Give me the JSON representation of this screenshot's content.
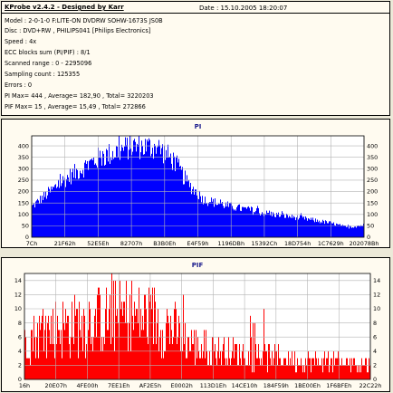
{
  "info": {
    "app_title": "KProbe v2.4.2 - Designed by Karr",
    "date_line": "Date : 15.10.2005 18:20:07",
    "lines": [
      "Model : 2-0-1-0 F:LITE-ON DVDRW SOHW-1673S JS0B",
      "Disc : DVD+RW , PHILIPS041 [Philips Electronics]",
      "Speed : 4x",
      "ECC blocks sum (PI/PIF) : 8/1",
      "Scanned range : 0 - 2295096",
      "Sampling count : 125355",
      "Errors : 0",
      "PI Max= 444 , Average= 182,90 , Total= 3220203",
      "PIF Max= 15 , Average= 15,49 , Total= 272866"
    ]
  },
  "colors": {
    "pi": "#0000ff",
    "pif": "#ff0000",
    "grid": "#b4b4b4",
    "title": "#1a1a8c"
  },
  "chart_data": [
    {
      "type": "bar",
      "title": "PI",
      "ylim": [
        0,
        444
      ],
      "yticks": [
        0,
        50,
        100,
        150,
        200,
        250,
        300,
        350,
        400
      ],
      "xtick_labels": [
        "7Ch",
        "21F62h",
        "52E5Eh",
        "82707h",
        "B3B0Eh",
        "E4F59h",
        "1196DBh",
        "15392Ch",
        "18D754h",
        "1C7629h",
        "202078Bh"
      ],
      "grid": true,
      "profile_x": [
        0,
        0.1,
        0.2,
        0.3,
        0.38,
        0.43,
        0.47,
        0.52,
        0.6,
        0.7,
        0.8,
        0.9,
        0.95,
        1.0
      ],
      "profile_y": [
        140,
        265,
        360,
        415,
        410,
        345,
        245,
        170,
        140,
        110,
        90,
        65,
        45,
        55
      ]
    },
    {
      "type": "bar",
      "title": "PIF",
      "ylim": [
        0,
        15
      ],
      "yticks": [
        0,
        2,
        4,
        6,
        8,
        10,
        12,
        14
      ],
      "xtick_labels": [
        "16h",
        "20E07h",
        "4FE00h",
        "7EE1Eh",
        "AF2E5h",
        "E0002h",
        "113D1Eh",
        "14CE10h",
        "184F59h",
        "1BE00Eh",
        "1F6BFEh",
        "22C22h"
      ],
      "grid": true,
      "profile_x": [
        0,
        0.1,
        0.2,
        0.3,
        0.38,
        0.43,
        0.47,
        0.52,
        0.6,
        0.7,
        0.8,
        0.9,
        1.0
      ],
      "profile_y": [
        5.5,
        7,
        8,
        8.5,
        8,
        6.5,
        5,
        4,
        3.5,
        3,
        2.5,
        2.2,
        2
      ]
    }
  ]
}
